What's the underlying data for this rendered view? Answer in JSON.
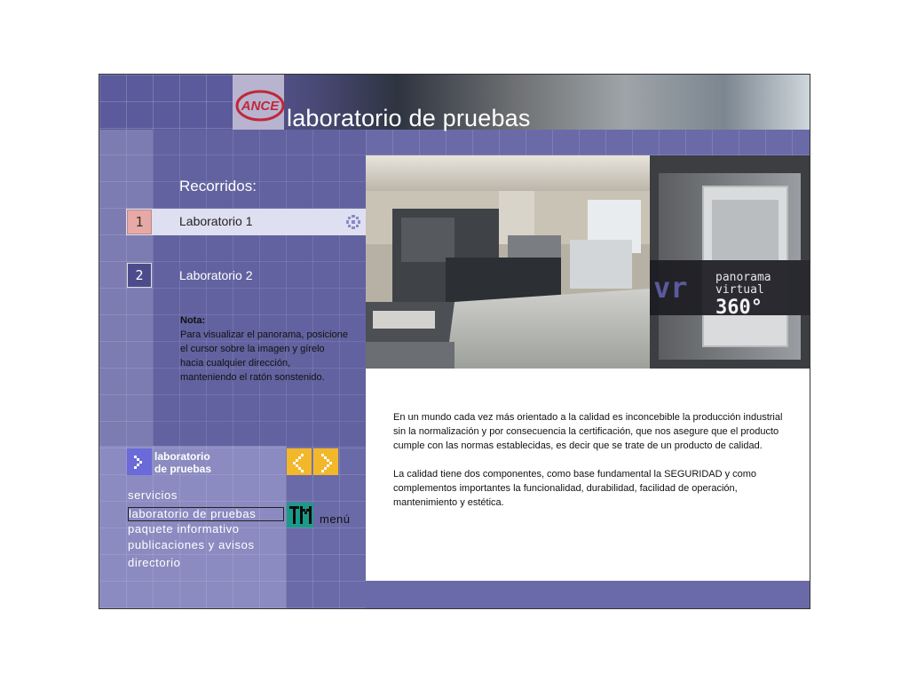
{
  "header": {
    "logo_text": "ANCE",
    "title": "laboratorio de pruebas"
  },
  "tours": {
    "heading": "Recorridos:",
    "items": [
      {
        "number": "1",
        "label": "Laboratorio 1",
        "selected": true
      },
      {
        "number": "2",
        "label": "Laboratorio 2",
        "selected": false
      }
    ]
  },
  "note": {
    "title": "Nota:",
    "text": "Para visualizar el panorama, posicione el cursor sobre la imagen y gírelo hacia cualquier dirección, manteniendo el ratón sonstenido."
  },
  "panorama": {
    "badge_vr": "vr",
    "badge_line1": "panorama",
    "badge_line2": "virtual",
    "badge_line3": "360°"
  },
  "body": {
    "paragraph1": "En un mundo cada vez más orientado a la calidad es inconcebible la producción industrial sin la normalización y por consecuencia la certificación, que nos asegure que el producto cumple con las normas establecidas, es decir que se trate de un producto de calidad.",
    "paragraph2": "La calidad tiene dos componentes, como base fundamental la SEGURIDAD y como complementos importantes la funcionalidad, durabilidad, facilidad de operación, mantenimiento y estética."
  },
  "nav": {
    "section_title_line1": "laboratorio",
    "section_title_line2": "de pruebas",
    "links": [
      "servicios",
      "laboratorio de pruebas",
      "paquete informativo",
      "publicaciones y avisos",
      "directorio"
    ],
    "active_link": "laboratorio de pruebas",
    "menu_label": "menú"
  },
  "colors": {
    "background_purple": "#6a6aa8",
    "accent_yellow": "#f2b82a",
    "menu_teal": "#1a9b8a",
    "tour1_pink": "#e7a9a6",
    "logo_red": "#c0283a"
  }
}
